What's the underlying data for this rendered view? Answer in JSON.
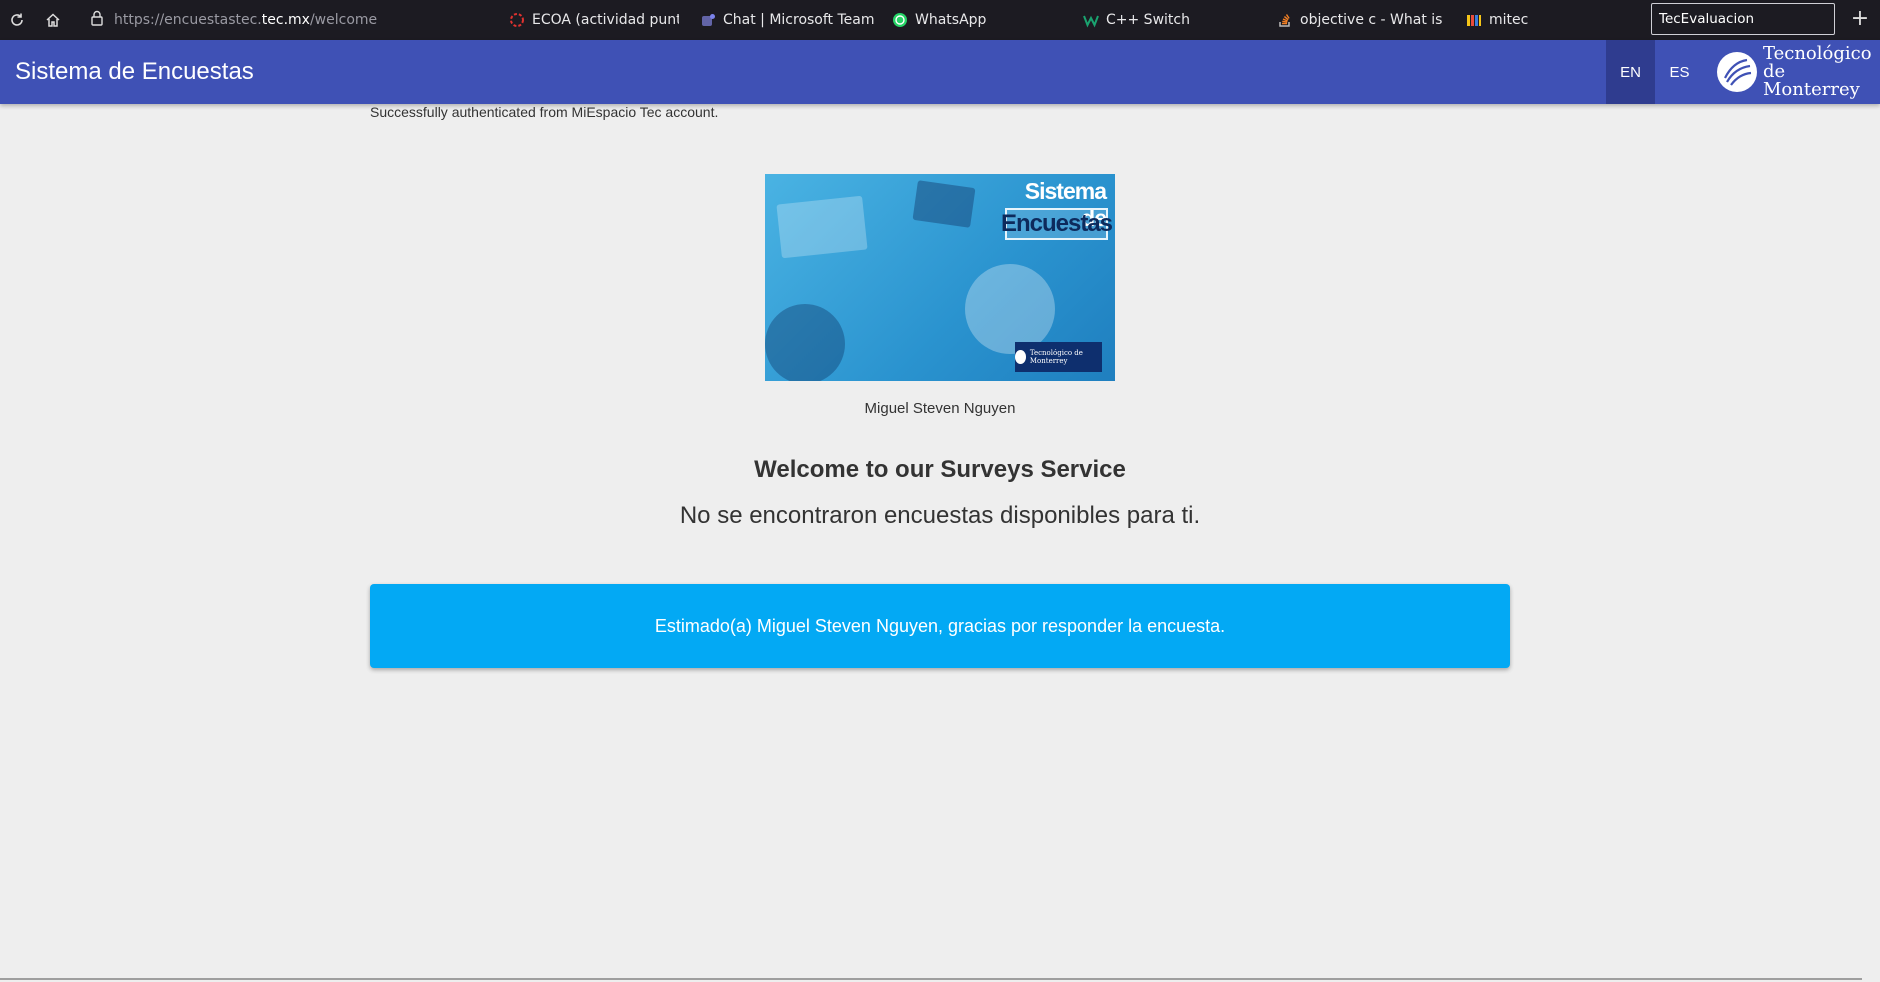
{
  "browser": {
    "url_path_prefix": "https://encuestastec.",
    "url_host": "tec.mx",
    "url_path_suffix": "/welcome",
    "bookmarks": [
      {
        "label": "ECOA (actividad puntos",
        "icon": "ecoa-ring-icon"
      },
      {
        "label": "Chat | Microsoft Teams",
        "icon": "teams-icon"
      },
      {
        "label": "WhatsApp",
        "icon": "whatsapp-icon"
      },
      {
        "label": "C++ Switch",
        "icon": "w-icon"
      },
      {
        "label": "objective c - What is cau",
        "icon": "stackoverflow-icon"
      },
      {
        "label": "mitec",
        "icon": "mitec-icon"
      }
    ],
    "tab_search_value": "TecEvaluacion",
    "new_tab": "+"
  },
  "header": {
    "title": "Sistema de Encuestas",
    "lang_en": "EN",
    "lang_es": "ES",
    "logo_line1": "Tecnológico",
    "logo_line2": "de Monterrey"
  },
  "main": {
    "auth_message": "Successfully authenticated from MiEspacio Tec account.",
    "banner": {
      "title_line1": "Sistema de",
      "title_line2": "Encuestas",
      "badge": "Tecnológico de Monterrey"
    },
    "user_name": "Miguel Steven Nguyen",
    "welcome_heading": "Welcome to our Surveys Service",
    "no_surveys_text": "No se encontraron encuestas disponibles para ti.",
    "info_card_text": "Estimado(a) Miguel Steven Nguyen, gracias por responder la encuesta."
  },
  "colors": {
    "header_bg": "#3f51b5",
    "header_active_lang": "#2f3c8f",
    "info_card_bg": "#03a9f4",
    "page_bg": "#eeeeee",
    "browser_bg": "#1c1b22"
  }
}
